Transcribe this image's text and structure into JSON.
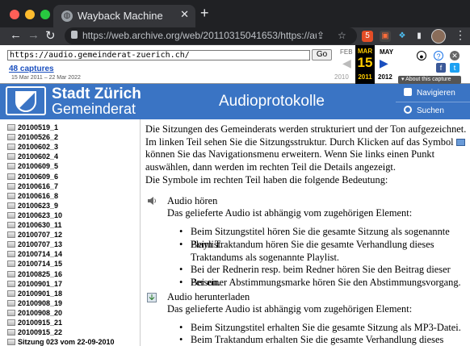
{
  "browser": {
    "tab_title": "Wayback Machine",
    "tab_close": "✕",
    "new_tab": "+",
    "url": "https://web.archive.org/web/20110315041653/https://audi...",
    "back": "←",
    "forward": "→",
    "reload": "↻"
  },
  "wayback": {
    "input_value": "https://audio.gemeinderat-zuerich.ch/",
    "go_label": "Go",
    "captures": "48 captures",
    "range": "15 Mar 2011 – 22 Mar 2022",
    "prev_month": "FEB",
    "cur_month": "MAR",
    "next_month": "MAY",
    "cur_day": "15",
    "prev_year": "2010",
    "cur_year": "2011",
    "next_year": "2012",
    "about": "▾ About this capture"
  },
  "header": {
    "brand_line1": "Stadt Zürich",
    "brand_line2": "Gemeinderat",
    "title": "Audioprotokolle",
    "nav_label": "Navigieren",
    "search_label": "Suchen"
  },
  "sessions": [
    "20100519_1",
    "20100526_2",
    "20100602_3",
    "20100602_4",
    "20100609_5",
    "20100609_6",
    "20100616_7",
    "20100616_8",
    "20100623_9",
    "20100623_10",
    "20100630_11",
    "20100707_12",
    "20100707_13",
    "20100714_14",
    "20100714_15",
    "20100825_16",
    "20100901_17",
    "20100901_18",
    "20100908_19",
    "20100908_20",
    "20100915_21",
    "20100915_22",
    "Sitzung 023 vom 22-09-2010"
  ],
  "content": {
    "intro_a": "Die Sitzungen des Gemeinderats werden strukturiert und der Ton aufgezeichnet. Im linken Teil sehen Sie die Sitzungsstruktur. Durch Klicken auf das Symbol",
    "intro_b": "können Sie das Navigationsmenu erweitern. Wenn Sie links einen Punkt auswählen, dann werden im rechten Teil die Details angezeigt.",
    "symbols_intro": "Die Symbole im rechten Teil haben die folgende Bedeutung:",
    "sections": [
      {
        "title": "Audio hören",
        "subtitle": "Das gelieferte Audio ist abhängig vom zugehörigen Element:",
        "bullets": [
          "Beim Sitzungstitel hören Sie die gesamte Sitzung als sogenannte Playlist.",
          "Beim Traktandum hören Sie die gesamte Verhandlung dieses Traktandums als sogenannte Playlist.",
          "Bei der Rednerin resp. beim Redner hören Sie den Beitrag dieser Person.",
          "Bei einer Abstimmungsmarke hören Sie den Abstimmungsvorgang."
        ]
      },
      {
        "title": "Audio herunterladen",
        "subtitle": "Das gelieferte Audio ist abhängig vom zugehörigen Element:",
        "bullets": [
          "Beim Sitzungstitel erhalten Sie die gesamte Sitzung als MP3-Datei.",
          "Beim Traktandum erhalten Sie die gesamte Verhandlung dieses"
        ]
      }
    ]
  },
  "colors": {
    "header_blue": "#3a74c4",
    "wayback_gold": "#ffcc00"
  }
}
